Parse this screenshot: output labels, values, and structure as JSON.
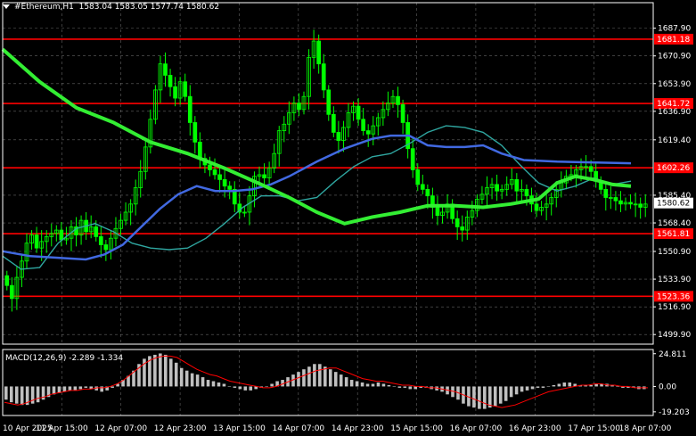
{
  "header": {
    "symbol": "#Ethereum,H1",
    "ohlc": "1583.04 1583.05 1577.74 1580.62"
  },
  "price_axis": {
    "ticks": [
      "1687.90",
      "1670.90",
      "1653.90",
      "1636.90",
      "1619.40",
      "1585.40",
      "1568.40",
      "1550.90",
      "1533.90",
      "1516.90",
      "1499.90"
    ],
    "tick_values": [
      1687.9,
      1670.9,
      1653.9,
      1636.9,
      1619.4,
      1585.4,
      1568.4,
      1550.9,
      1533.9,
      1516.9,
      1499.9
    ]
  },
  "levels": [
    {
      "label": "1681.18",
      "value": 1681.18
    },
    {
      "label": "1641.72",
      "value": 1641.72
    },
    {
      "label": "1602.26",
      "value": 1602.26
    },
    {
      "label": "1561.81",
      "value": 1561.81
    },
    {
      "label": "1523.36",
      "value": 1523.36
    }
  ],
  "current_price": {
    "label": "1580.62",
    "value": 1580.62
  },
  "time_axis": [
    "10 Apr 2025",
    "11 Apr 15:00",
    "12 Apr 07:00",
    "12 Apr 23:00",
    "13 Apr 15:00",
    "14 Apr 07:00",
    "14 Apr 23:00",
    "15 Apr 15:00",
    "16 Apr 07:00",
    "16 Apr 23:00",
    "17 Apr 15:00",
    "18 Apr 07:00"
  ],
  "macd": {
    "label": "MACD(12,26,9) -2.289 -1.334",
    "ticks": [
      "24.811",
      "0.00",
      "-19.203"
    ],
    "tick_values": [
      24.811,
      0,
      -19.203
    ]
  },
  "colors": {
    "background": "#000000",
    "candle": "#00ff00",
    "grid": "#c8c8c8",
    "level_line": "#ff0000",
    "level_label_bg": "#ff0000",
    "ma_fast": "#2fa6a0",
    "ma_mid": "#4169e1",
    "ma_slow": "#33ee33",
    "macd_hist": "#c0c0c0",
    "macd_signal": "#ff0000",
    "price_label_bg": "#ffffff"
  },
  "chart_data": {
    "type": "candlestick",
    "price_range": [
      1494,
      1697
    ],
    "macd_range": [
      -22,
      28
    ],
    "moving_averages": {
      "fast": [
        [
          0,
          1548
        ],
        [
          10,
          1540
        ],
        [
          20,
          1541
        ],
        [
          30,
          1556
        ],
        [
          40,
          1565
        ],
        [
          50,
          1568
        ],
        [
          60,
          1563
        ],
        [
          70,
          1556
        ],
        [
          80,
          1553
        ],
        [
          90,
          1552
        ],
        [
          100,
          1553
        ],
        [
          110,
          1559
        ],
        [
          120,
          1568
        ],
        [
          130,
          1578
        ],
        [
          140,
          1585
        ],
        [
          150,
          1585
        ],
        [
          160,
          1582
        ],
        [
          170,
          1584
        ],
        [
          180,
          1594
        ],
        [
          190,
          1603
        ],
        [
          200,
          1609
        ],
        [
          210,
          1611
        ],
        [
          220,
          1617
        ],
        [
          230,
          1624
        ],
        [
          240,
          1628
        ],
        [
          250,
          1627
        ],
        [
          260,
          1624
        ],
        [
          270,
          1616
        ],
        [
          280,
          1604
        ],
        [
          290,
          1593
        ],
        [
          300,
          1588
        ],
        [
          310,
          1591
        ],
        [
          320,
          1596
        ],
        [
          330,
          1592
        ],
        [
          340,
          1594
        ]
      ],
      "mid": [
        [
          0,
          1551
        ],
        [
          15,
          1548
        ],
        [
          30,
          1547
        ],
        [
          45,
          1546
        ],
        [
          55,
          1549
        ],
        [
          65,
          1555
        ],
        [
          75,
          1566
        ],
        [
          85,
          1577
        ],
        [
          95,
          1586
        ],
        [
          105,
          1591
        ],
        [
          115,
          1588
        ],
        [
          125,
          1588
        ],
        [
          135,
          1589
        ],
        [
          145,
          1592
        ],
        [
          155,
          1597
        ],
        [
          170,
          1606
        ],
        [
          185,
          1614
        ],
        [
          200,
          1620
        ],
        [
          210,
          1622
        ],
        [
          220,
          1622
        ],
        [
          230,
          1616
        ],
        [
          240,
          1615
        ],
        [
          250,
          1615
        ],
        [
          260,
          1616
        ],
        [
          270,
          1611
        ],
        [
          282,
          1607
        ],
        [
          300,
          1606
        ],
        [
          340,
          1605
        ]
      ],
      "slow": [
        [
          0,
          1675
        ],
        [
          20,
          1655
        ],
        [
          40,
          1639
        ],
        [
          60,
          1630
        ],
        [
          80,
          1618
        ],
        [
          100,
          1611
        ],
        [
          120,
          1602
        ],
        [
          140,
          1592
        ],
        [
          155,
          1584
        ],
        [
          170,
          1575
        ],
        [
          185,
          1568
        ],
        [
          200,
          1572
        ],
        [
          215,
          1575
        ],
        [
          230,
          1579
        ],
        [
          245,
          1579
        ],
        [
          260,
          1578
        ],
        [
          275,
          1580
        ],
        [
          290,
          1583
        ],
        [
          300,
          1593
        ],
        [
          310,
          1597
        ],
        [
          320,
          1595
        ],
        [
          330,
          1592
        ],
        [
          340,
          1591
        ]
      ]
    },
    "candles_close": [
      1530,
      1522,
      1535,
      1545,
      1556,
      1561,
      1553,
      1557,
      1560,
      1562,
      1564,
      1558,
      1559,
      1566,
      1561,
      1570,
      1563,
      1566,
      1560,
      1555,
      1552,
      1559,
      1565,
      1570,
      1575,
      1580,
      1590,
      1600,
      1615,
      1632,
      1650,
      1666,
      1659,
      1652,
      1645,
      1655,
      1646,
      1630,
      1618,
      1608,
      1604,
      1601,
      1598,
      1595,
      1591,
      1589,
      1580,
      1575,
      1575,
      1585,
      1597,
      1598,
      1596,
      1602,
      1611,
      1625,
      1629,
      1636,
      1642,
      1638,
      1646,
      1670,
      1680,
      1666,
      1650,
      1635,
      1624,
      1619,
      1627,
      1636,
      1640,
      1632,
      1625,
      1623,
      1628,
      1633,
      1638,
      1642,
      1646,
      1641,
      1630,
      1614,
      1601,
      1592,
      1589,
      1585,
      1578,
      1573,
      1575,
      1580,
      1571,
      1566,
      1564,
      1572,
      1576,
      1583,
      1586,
      1590,
      1592,
      1588,
      1589,
      1592,
      1595,
      1588,
      1589,
      1585,
      1580,
      1576,
      1578,
      1580,
      1584,
      1589,
      1593,
      1597,
      1598,
      1601,
      1603,
      1603,
      1600,
      1594,
      1589,
      1584,
      1584,
      1582,
      1580,
      1581,
      1580,
      1580,
      1578,
      1580
    ],
    "macd_hist": [
      -10,
      -12,
      -13,
      -14,
      -14,
      -13,
      -12,
      -10,
      -8,
      -6,
      -5,
      -4,
      -3,
      -3,
      -2,
      -1,
      -2,
      -3,
      -4,
      -3,
      -1,
      2,
      5,
      8,
      12,
      17,
      21,
      23,
      24,
      25,
      24,
      21,
      18,
      14,
      12,
      10,
      9,
      7,
      5,
      4,
      3,
      2,
      0,
      -1,
      -2,
      -3,
      -3,
      -2,
      -1,
      0,
      2,
      4,
      5,
      7,
      9,
      11,
      13,
      15,
      17,
      17,
      15,
      13,
      11,
      9,
      7,
      5,
      4,
      3,
      2,
      2,
      3,
      2,
      1,
      0,
      -1,
      -1,
      -2,
      -2,
      -1,
      -1,
      -2,
      -3,
      -4,
      -6,
      -8,
      -10,
      -13,
      -15,
      -16,
      -17,
      -17,
      -16,
      -15,
      -13,
      -11,
      -8,
      -6,
      -4,
      -3,
      -2,
      -1,
      -1,
      0,
      1,
      2,
      3,
      3,
      2,
      1,
      1,
      1,
      2,
      2,
      2,
      1,
      0,
      -1,
      -1,
      -1,
      -2,
      -2
    ],
    "macd_signal": [
      -12,
      -13,
      -14,
      -13,
      -11,
      -9,
      -8,
      -6,
      -5,
      -4,
      -3,
      -3,
      -2,
      -2,
      -1,
      -1,
      0,
      2,
      5,
      9,
      13,
      17,
      20,
      22,
      23,
      23,
      22,
      19,
      16,
      13,
      11,
      9,
      8,
      6,
      4,
      3,
      2,
      1,
      0,
      -1,
      -1,
      0,
      2,
      4,
      6,
      8,
      10,
      12,
      13,
      14,
      14,
      12,
      10,
      8,
      6,
      5,
      4,
      4,
      3,
      2,
      1,
      1,
      0,
      0,
      -1,
      -1,
      -2,
      -3,
      -4,
      -6,
      -8,
      -10,
      -12,
      -14,
      -15,
      -16,
      -15,
      -14,
      -12,
      -10,
      -8,
      -6,
      -4,
      -3,
      -2,
      -1,
      0,
      1,
      1,
      2,
      2,
      1,
      1,
      0,
      0,
      -1,
      -1,
      -1
    ]
  }
}
